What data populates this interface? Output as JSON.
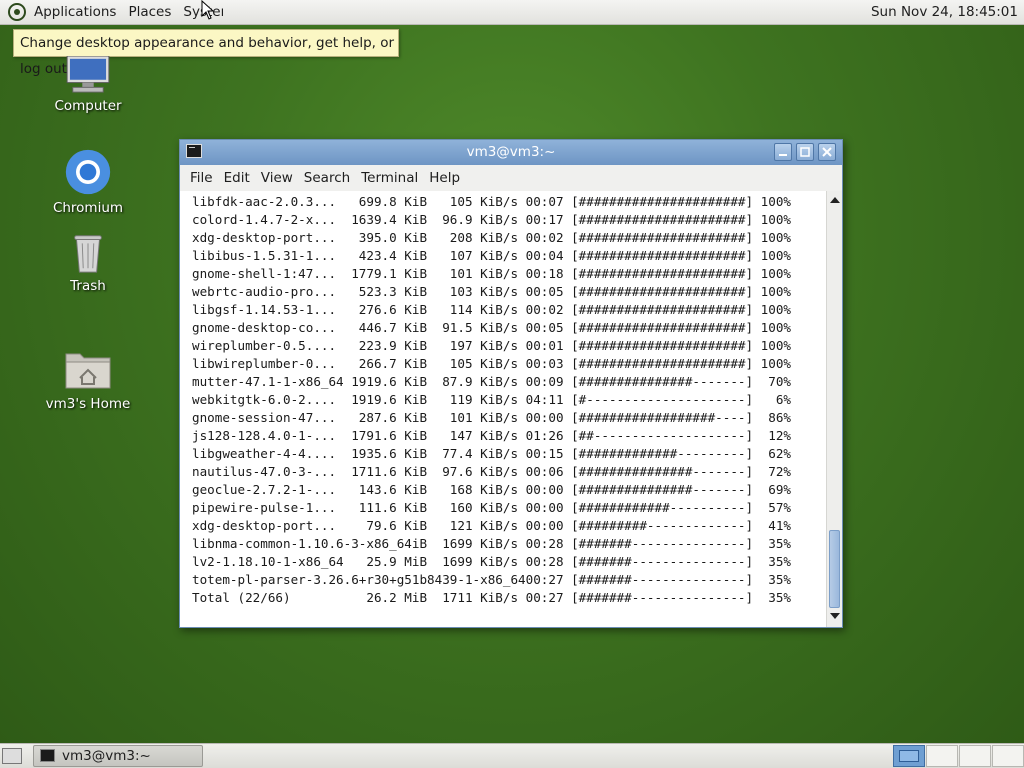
{
  "top_panel": {
    "menus": [
      "Applications",
      "Places",
      "System"
    ],
    "clock": "Sun Nov 24, 18:45:01"
  },
  "tooltip": "Change desktop appearance and behavior, get help, or log out",
  "desktop_icons": [
    {
      "label": "Computer"
    },
    {
      "label": "Chromium"
    },
    {
      "label": "Trash"
    },
    {
      "label": "vm3's Home"
    }
  ],
  "window": {
    "title": "vm3@vm3:~",
    "menu": [
      "File",
      "Edit",
      "View",
      "Search",
      "Terminal",
      "Help"
    ],
    "lines": [
      "libfdk-aac-2.0.3...   699.8 KiB   105 KiB/s 00:07 [######################] 100%",
      "colord-1.4.7-2-x...  1639.4 KiB  96.9 KiB/s 00:17 [######################] 100%",
      "xdg-desktop-port...   395.0 KiB   208 KiB/s 00:02 [######################] 100%",
      "libibus-1.5.31-1...   423.4 KiB   107 KiB/s 00:04 [######################] 100%",
      "gnome-shell-1:47...  1779.1 KiB   101 KiB/s 00:18 [######################] 100%",
      "webrtc-audio-pro...   523.3 KiB   103 KiB/s 00:05 [######################] 100%",
      "libgsf-1.14.53-1...   276.6 KiB   114 KiB/s 00:02 [######################] 100%",
      "gnome-desktop-co...   446.7 KiB  91.5 KiB/s 00:05 [######################] 100%",
      "wireplumber-0.5....   223.9 KiB   197 KiB/s 00:01 [######################] 100%",
      "libwireplumber-0...   266.7 KiB   105 KiB/s 00:03 [######################] 100%",
      "mutter-47.1-1-x86_64 1919.6 KiB  87.9 KiB/s 00:09 [###############-------]  70%",
      "webkitgtk-6.0-2....  1919.6 KiB   119 KiB/s 04:11 [#---------------------]   6%",
      "gnome-session-47...   287.6 KiB   101 KiB/s 00:00 [##################----]  86%",
      "js128-128.4.0-1-...  1791.6 KiB   147 KiB/s 01:26 [##--------------------]  12%",
      "libgweather-4-4....  1935.6 KiB  77.4 KiB/s 00:15 [#############---------]  62%",
      "nautilus-47.0-3-...  1711.6 KiB  97.6 KiB/s 00:06 [###############-------]  72%",
      "geoclue-2.7.2-1-...   143.6 KiB   168 KiB/s 00:00 [###############-------]  69%",
      "pipewire-pulse-1...   111.6 KiB   160 KiB/s 00:00 [############----------]  57%",
      "xdg-desktop-port...    79.6 KiB   121 KiB/s 00:00 [#########-------------]  41%",
      "libnma-common-1.10.6-3-x86_64iB  1699 KiB/s 00:28 [#######---------------]  35%",
      "lv2-1.18.10-1-x86_64   25.9 MiB  1699 KiB/s 00:28 [#######---------------]  35%",
      "totem-pl-parser-3.26.6+r30+g51b8439-1-x86_6400:27 [#######---------------]  35%",
      "Total (22/66)          26.2 MiB  1711 KiB/s 00:27 [#######---------------]  35%"
    ]
  },
  "taskbar": {
    "task_label": "vm3@vm3:~"
  }
}
